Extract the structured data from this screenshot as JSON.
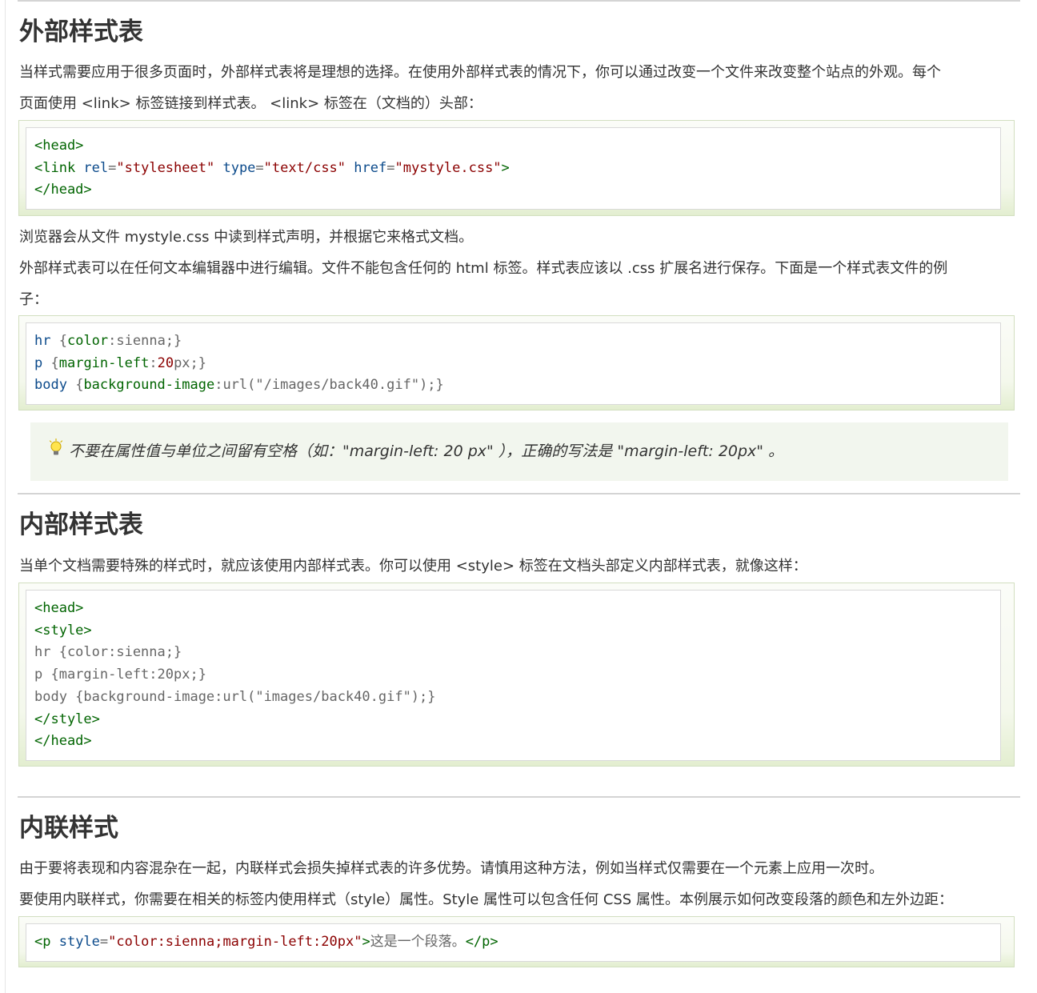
{
  "section1": {
    "title": "外部样式表",
    "p1_line1": "当样式需要应用于很多页面时，外部样式表将是理想的选择。在使用外部样式表的情况下，你可以通过改变一个文件来改变整个站点的外观。每个",
    "p1_line2": "页面使用 <link> 标签链接到样式表。 <link> 标签在（文档的）头部：",
    "code1": {
      "l1_tag": "<head>",
      "l2_open": "<link ",
      "l2_a1": "rel",
      "l2_eq1": "=",
      "l2_v1": "\"stylesheet\"",
      "l2_a2": "type",
      "l2_eq2": "=",
      "l2_v2": "\"text/css\"",
      "l2_a3": "href",
      "l2_eq3": "=",
      "l2_v3": "\"mystyle.css\"",
      "l2_close": ">",
      "l3_tag": "</head>"
    },
    "p2": "浏览器会从文件 mystyle.css 中读到样式声明，并根据它来格式文档。",
    "p3_line1": "外部样式表可以在任何文本编辑器中进行编辑。文件不能包含任何的 html 标签。样式表应该以 .css 扩展名进行保存。下面是一个样式表文件的例",
    "p3_line2": "子：",
    "code2": {
      "l1_sel": "hr",
      "l1_open": " {",
      "l1_prop": "color",
      "l1_rest": ":sienna;}",
      "l2_sel": "p",
      "l2_open": " {",
      "l2_prop": "margin-left",
      "l2_colon": ":",
      "l2_num": "20",
      "l2_rest": "px;}",
      "l3_sel": "body",
      "l3_open": " {",
      "l3_prop": "background-image",
      "l3_rest": ":url(\"/images/back40.gif\");}"
    },
    "tip": "不要在属性值与单位之间留有空格（如：\"margin-left: 20 px\" ），正确的写法是 \"margin-left: 20px\" 。"
  },
  "section2": {
    "title": "内部样式表",
    "p1": "当单个文档需要特殊的样式时，就应该使用内部样式表。你可以使用 <style> 标签在文档头部定义内部样式表，就像这样：",
    "code": {
      "l1": "<head>",
      "l2": "<style>",
      "l3": "hr {color:sienna;}",
      "l4": "p {margin-left:20px;}",
      "l5": "body {background-image:url(\"images/back40.gif\");}",
      "l6": "</style>",
      "l7": "</head>"
    }
  },
  "section3": {
    "title": "内联样式",
    "p1": "由于要将表现和内容混杂在一起，内联样式会损失掉样式表的许多优势。请慎用这种方法，例如当样式仅需要在一个元素上应用一次时。",
    "p2": "要使用内联样式，你需要在相关的标签内使用样式（style）属性。Style 属性可以包含任何 CSS 属性。本例展示如何改变段落的颜色和左外边距：",
    "code": {
      "open": "<p ",
      "attr": "style",
      "eq": "=",
      "val": "\"color:sienna;margin-left:20px\"",
      "close": ">",
      "text": "这是一个段落。",
      "end": "</p>"
    }
  },
  "icons": {
    "tip": "lightbulb-icon"
  }
}
